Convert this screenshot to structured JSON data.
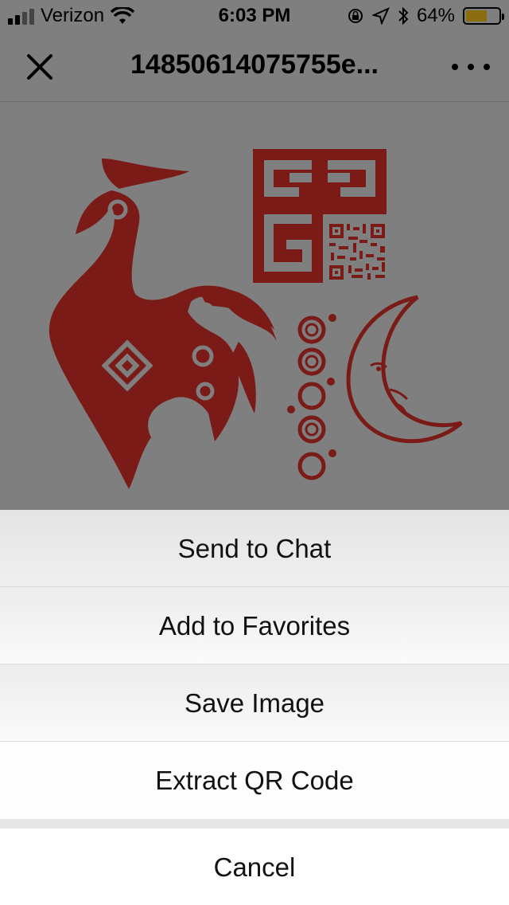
{
  "status_bar": {
    "carrier": "Verizon",
    "time": "6:03 PM",
    "battery_percent": "64%",
    "battery_level": 0.64,
    "icons": [
      "signal-icon",
      "wifi-icon",
      "orientation-lock-icon",
      "location-icon",
      "bluetooth-icon",
      "battery-icon"
    ]
  },
  "nav": {
    "title": "14850614075755e...",
    "close_icon": "close-icon",
    "more_icon": "more-icon"
  },
  "image": {
    "accent_color": "#8b1f1a"
  },
  "action_sheet": {
    "items": [
      {
        "label": "Send to Chat"
      },
      {
        "label": "Add to Favorites"
      },
      {
        "label": "Save Image"
      },
      {
        "label": "Extract QR Code"
      }
    ],
    "cancel_label": "Cancel"
  }
}
